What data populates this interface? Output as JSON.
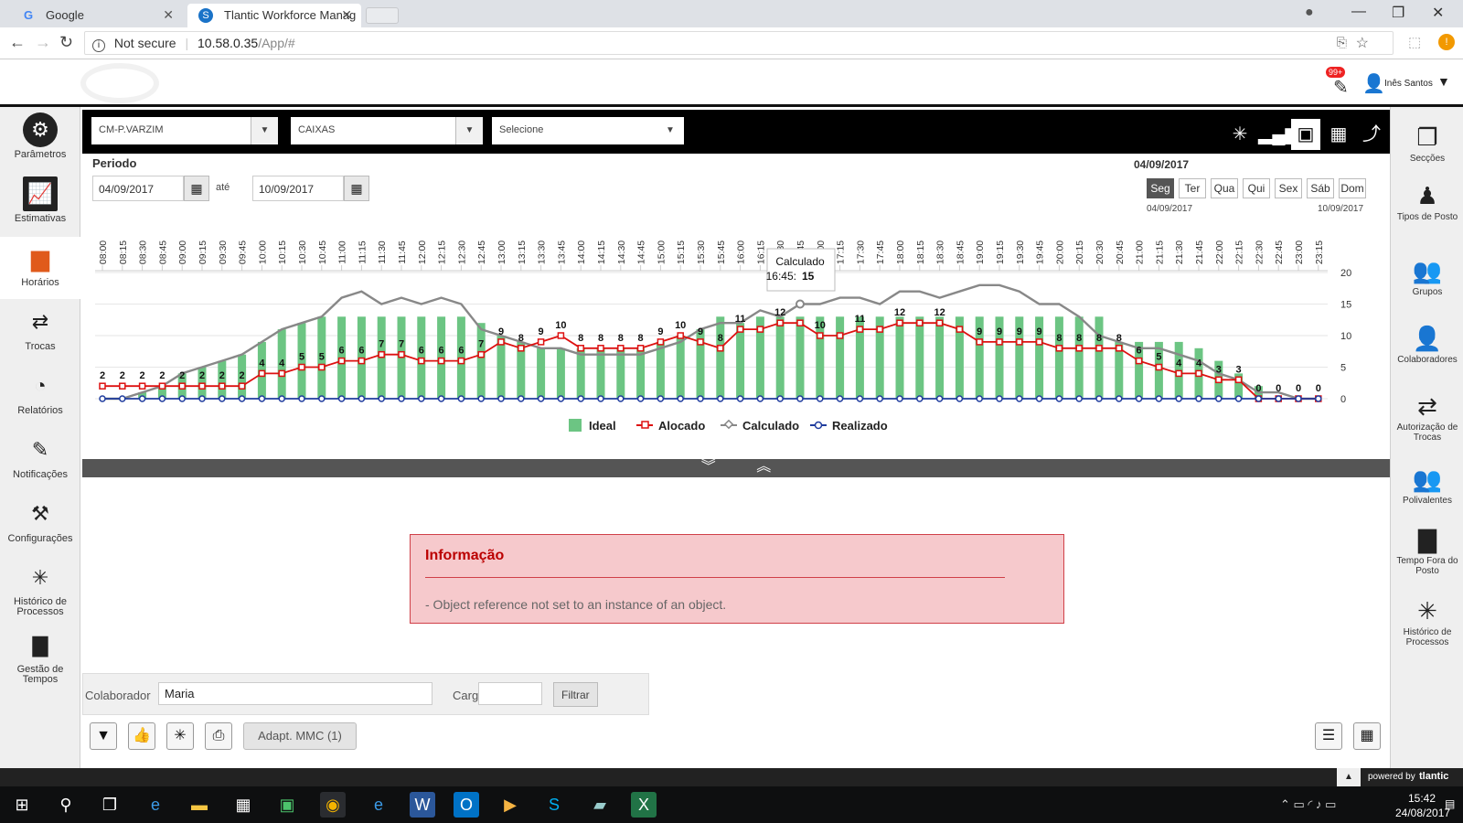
{
  "browser": {
    "tabs": [
      {
        "label": "Google"
      },
      {
        "label": "Tlantic Workforce Manag"
      }
    ],
    "security": "Not secure",
    "url_host": "10.58.0.35",
    "url_path": "/App/#"
  },
  "header": {
    "badge": "99+",
    "user": "Inês Santos"
  },
  "left_nav": [
    {
      "label": "Parâmetros"
    },
    {
      "label": "Estimativas"
    },
    {
      "label": "Horários"
    },
    {
      "label": "Trocas"
    },
    {
      "label": "Relatórios"
    },
    {
      "label": "Notificações"
    },
    {
      "label": "Configurações"
    },
    {
      "label": "Histórico de Processos"
    },
    {
      "label": "Gestão de Tempos"
    }
  ],
  "right_nav": [
    {
      "label": "Secções"
    },
    {
      "label": "Tipos de Posto"
    },
    {
      "label": "Grupos"
    },
    {
      "label": "Colaboradores"
    },
    {
      "label": "Autorização de Trocas"
    },
    {
      "label": "Polivalentes"
    },
    {
      "label": "Tempo Fora do Posto"
    },
    {
      "label": "Histórico de Processos"
    }
  ],
  "filters": {
    "store": "CM-P.VARZIM",
    "section": "CAIXAS",
    "select": "Selecione"
  },
  "period": {
    "label": "Periodo",
    "from": "04/09/2017",
    "to_label": "até",
    "to": "10/09/2017"
  },
  "week": {
    "current": "04/09/2017",
    "days": [
      "Seg",
      "Ter",
      "Qua",
      "Qui",
      "Sex",
      "Sáb",
      "Dom"
    ],
    "start": "04/09/2017",
    "end": "10/09/2017"
  },
  "chart_data": {
    "type": "bar",
    "x": [
      "08:00",
      "08:15",
      "08:30",
      "08:45",
      "09:00",
      "09:15",
      "09:30",
      "09:45",
      "10:00",
      "10:15",
      "10:30",
      "10:45",
      "11:00",
      "11:15",
      "11:30",
      "11:45",
      "12:00",
      "12:15",
      "12:30",
      "12:45",
      "13:00",
      "13:15",
      "13:30",
      "13:45",
      "14:00",
      "14:15",
      "14:30",
      "14:45",
      "15:00",
      "15:15",
      "15:30",
      "15:45",
      "16:00",
      "16:15",
      "16:30",
      "16:45",
      "17:00",
      "17:15",
      "17:30",
      "17:45",
      "18:00",
      "18:15",
      "18:30",
      "18:45",
      "19:00",
      "19:15",
      "19:30",
      "19:45",
      "20:00",
      "20:15",
      "20:30",
      "20:45",
      "21:00",
      "21:15",
      "21:30",
      "21:45",
      "22:00",
      "22:15",
      "22:30",
      "22:45",
      "23:00",
      "23:15"
    ],
    "ylim": [
      0,
      20
    ],
    "yticks": [
      0,
      5,
      10,
      15,
      20
    ],
    "series": [
      {
        "name": "Ideal",
        "type": "bar",
        "color": "#6cc583",
        "values": [
          0,
          0,
          1,
          2,
          4,
          5,
          6,
          7,
          9,
          11,
          12,
          13,
          13,
          13,
          13,
          13,
          13,
          13,
          13,
          12,
          10,
          9,
          8,
          8,
          8,
          8,
          8,
          8,
          9,
          10,
          11,
          13,
          12,
          13,
          13,
          13,
          13,
          13,
          13,
          13,
          13,
          13,
          13,
          13,
          13,
          13,
          13,
          13,
          13,
          13,
          13,
          9,
          9,
          9,
          9,
          8,
          6,
          4,
          2,
          0,
          0,
          0
        ]
      },
      {
        "name": "Alocado",
        "type": "line",
        "color": "#dd1111",
        "values": [
          2,
          2,
          2,
          2,
          2,
          2,
          2,
          2,
          4,
          4,
          5,
          5,
          6,
          6,
          7,
          7,
          6,
          6,
          6,
          7,
          9,
          8,
          9,
          10,
          8,
          8,
          8,
          8,
          9,
          10,
          9,
          8,
          11,
          11,
          12,
          12,
          10,
          10,
          11,
          11,
          12,
          12,
          12,
          11,
          9,
          9,
          9,
          9,
          8,
          8,
          8,
          8,
          6,
          5,
          4,
          4,
          3,
          3,
          0,
          0,
          0,
          0
        ]
      },
      {
        "name": "Calculado",
        "type": "line",
        "color": "#888888",
        "values": [
          0,
          0,
          1,
          2,
          4,
          5,
          6,
          7,
          9,
          11,
          12,
          13,
          16,
          17,
          15,
          16,
          15,
          16,
          15,
          11,
          10,
          9,
          8,
          8,
          7,
          7,
          7,
          7,
          8,
          9,
          11,
          12,
          12,
          14,
          13,
          15,
          15,
          16,
          16,
          15,
          17,
          17,
          16,
          17,
          18,
          18,
          17,
          15,
          15,
          13,
          10,
          9,
          8,
          8,
          7,
          6,
          4,
          3,
          1,
          1,
          0,
          0
        ]
      },
      {
        "name": "Realizado",
        "type": "line",
        "color": "#1f3c9e",
        "values": [
          0,
          0,
          0,
          0,
          0,
          0,
          0,
          0,
          0,
          0,
          0,
          0,
          0,
          0,
          0,
          0,
          0,
          0,
          0,
          0,
          0,
          0,
          0,
          0,
          0,
          0,
          0,
          0,
          0,
          0,
          0,
          0,
          0,
          0,
          0,
          0,
          0,
          0,
          0,
          0,
          0,
          0,
          0,
          0,
          0,
          0,
          0,
          0,
          0,
          0,
          0,
          0,
          0,
          0,
          0,
          0,
          0,
          0,
          0,
          0,
          0,
          0
        ]
      }
    ],
    "data_labels": [
      2,
      2,
      2,
      2,
      2,
      2,
      2,
      2,
      4,
      4,
      5,
      5,
      6,
      6,
      7,
      7,
      6,
      6,
      6,
      7,
      9,
      8,
      9,
      10,
      8,
      8,
      8,
      8,
      9,
      10,
      9,
      8,
      11,
      null,
      12,
      null,
      10,
      null,
      11,
      null,
      12,
      null,
      12,
      null,
      9,
      9,
      9,
      9,
      8,
      8,
      8,
      8,
      6,
      5,
      4,
      4,
      3,
      3,
      0,
      0,
      0,
      0
    ],
    "tooltip": {
      "title": "Calculado",
      "time": "16:45",
      "value": "15"
    },
    "legend": "bottom"
  },
  "info": {
    "title": "Informação",
    "message": "- Object reference not set to an instance of an object."
  },
  "collab": {
    "label": "Colaborador",
    "value": "Maria",
    "carga_label": "Carga:",
    "carga_value": "",
    "filter": "Filtrar"
  },
  "toolbar": {
    "adapt": "Adapt. MMC (1)"
  },
  "footer": {
    "powered": "powered by",
    "brand": "tlantic"
  },
  "taskbar": {
    "time": "15:42",
    "date": "24/08/2017"
  }
}
